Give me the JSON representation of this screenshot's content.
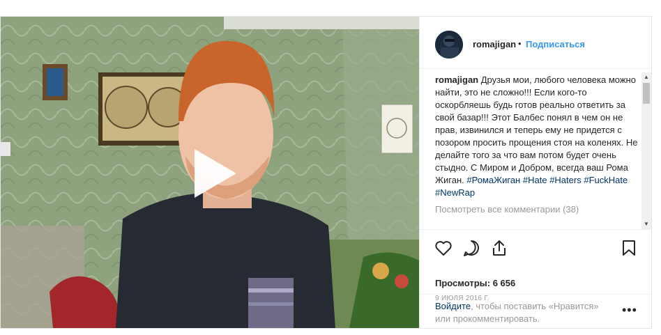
{
  "header": {
    "username": "romajigan",
    "separator": "•",
    "follow_label": "Подписаться"
  },
  "caption": {
    "username": "romajigan",
    "text": "Друзья мои, любого человека можно найти, это не сложно!!! Если кого-то оскорбляешь будь готов реально ответить за свой базар!!! Этот Балбес понял в чем он не прав, извинился и теперь ему не придется с позором просить прощения стоя на коленях. Не делайте того за что вам потом будет очень стыдно. С Миром и Добром, всегда ваш Рома Жиган.",
    "hashtags": [
      "#РомаЖиган",
      "#Hate",
      "#Haters",
      "#FuckHate",
      "#NewRap"
    ],
    "view_all_comments": "Посмотреть все комментарии (38)"
  },
  "actions": {
    "icons": [
      "heart-icon",
      "comment-icon",
      "share-icon",
      "bookmark-icon"
    ]
  },
  "stats": {
    "views": "Просмотры: 6 656",
    "date": "9 ИЮЛЯ 2016 Г."
  },
  "login_prompt": {
    "link": "Войдите",
    "rest": ", чтобы поставить «Нравится» или прокомментировать."
  },
  "colors": {
    "link_blue": "#3897f0",
    "hashtag": "#003569",
    "muted": "#999999",
    "wall_green": "#8fa37f"
  }
}
